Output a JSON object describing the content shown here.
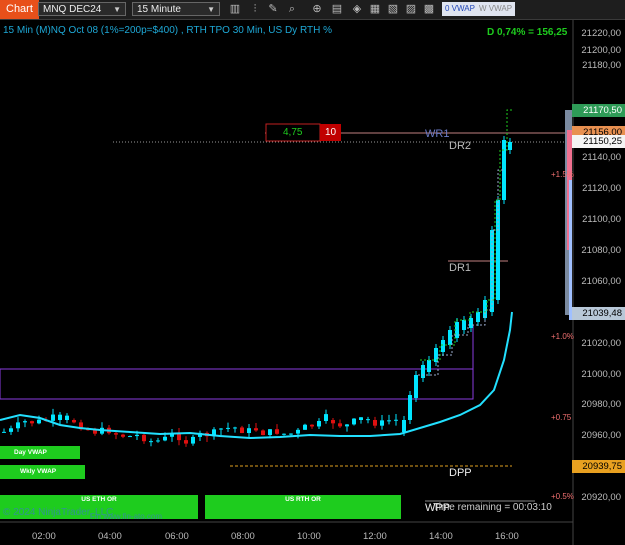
{
  "toolbar": {
    "chart_tab": "Chart",
    "instrument": "MNQ DEC24",
    "timeframe": "15 Minute",
    "vwap_on": "0 VWAP",
    "vwap_off": "W VWAP"
  },
  "header": {
    "info": "15 Min (M)NQ Oct 08 (1%=200p=$400) , RTH TPO 30 Min, US Dy RTH %",
    "delta": "D 0,74% = 156,25"
  },
  "levels": {
    "wr1": "WR1",
    "dr2": "DR2",
    "dr1": "DR1",
    "dpp": "DPP",
    "wpp": "WPP"
  },
  "order_box": {
    "value": "4,75",
    "qty": "10"
  },
  "percent_labels": [
    "+1.5%",
    "+1.0%",
    "+0.75",
    "+0.5%"
  ],
  "boxes": {
    "day_vwap": "Day VWAP",
    "wkly_vwap": "Wkly VWAP",
    "us_eth_or": "US ETH OR",
    "us_rth_or": "US RTH OR"
  },
  "watermark": "© 2024 NinjaTrader, LLC",
  "watermark2": "Fin  www.fin-ato.com",
  "time_remaining": "Time remaining = 00:03:10",
  "price_axis": [
    "21220,00",
    "21200,00",
    "21180,00",
    "21140,00",
    "21120,00",
    "21100,00",
    "21080,00",
    "21060,00",
    "21020,00",
    "21000,00",
    "20980,00",
    "20960,00",
    "20920,00"
  ],
  "price_labels": {
    "p1": "21170,50",
    "p2": "21156,00",
    "p3": "21150,25",
    "p4": "21039,48",
    "p5": "20939,75"
  },
  "time_axis": [
    "02:00",
    "04:00",
    "06:00",
    "08:00",
    "10:00",
    "12:00",
    "14:00",
    "16:00"
  ],
  "colors": {
    "accent": "#e8501a",
    "up": "#00e5ff",
    "down": "#e01010",
    "vwap": "#22e0ff",
    "green": "#1ecc1e"
  }
}
